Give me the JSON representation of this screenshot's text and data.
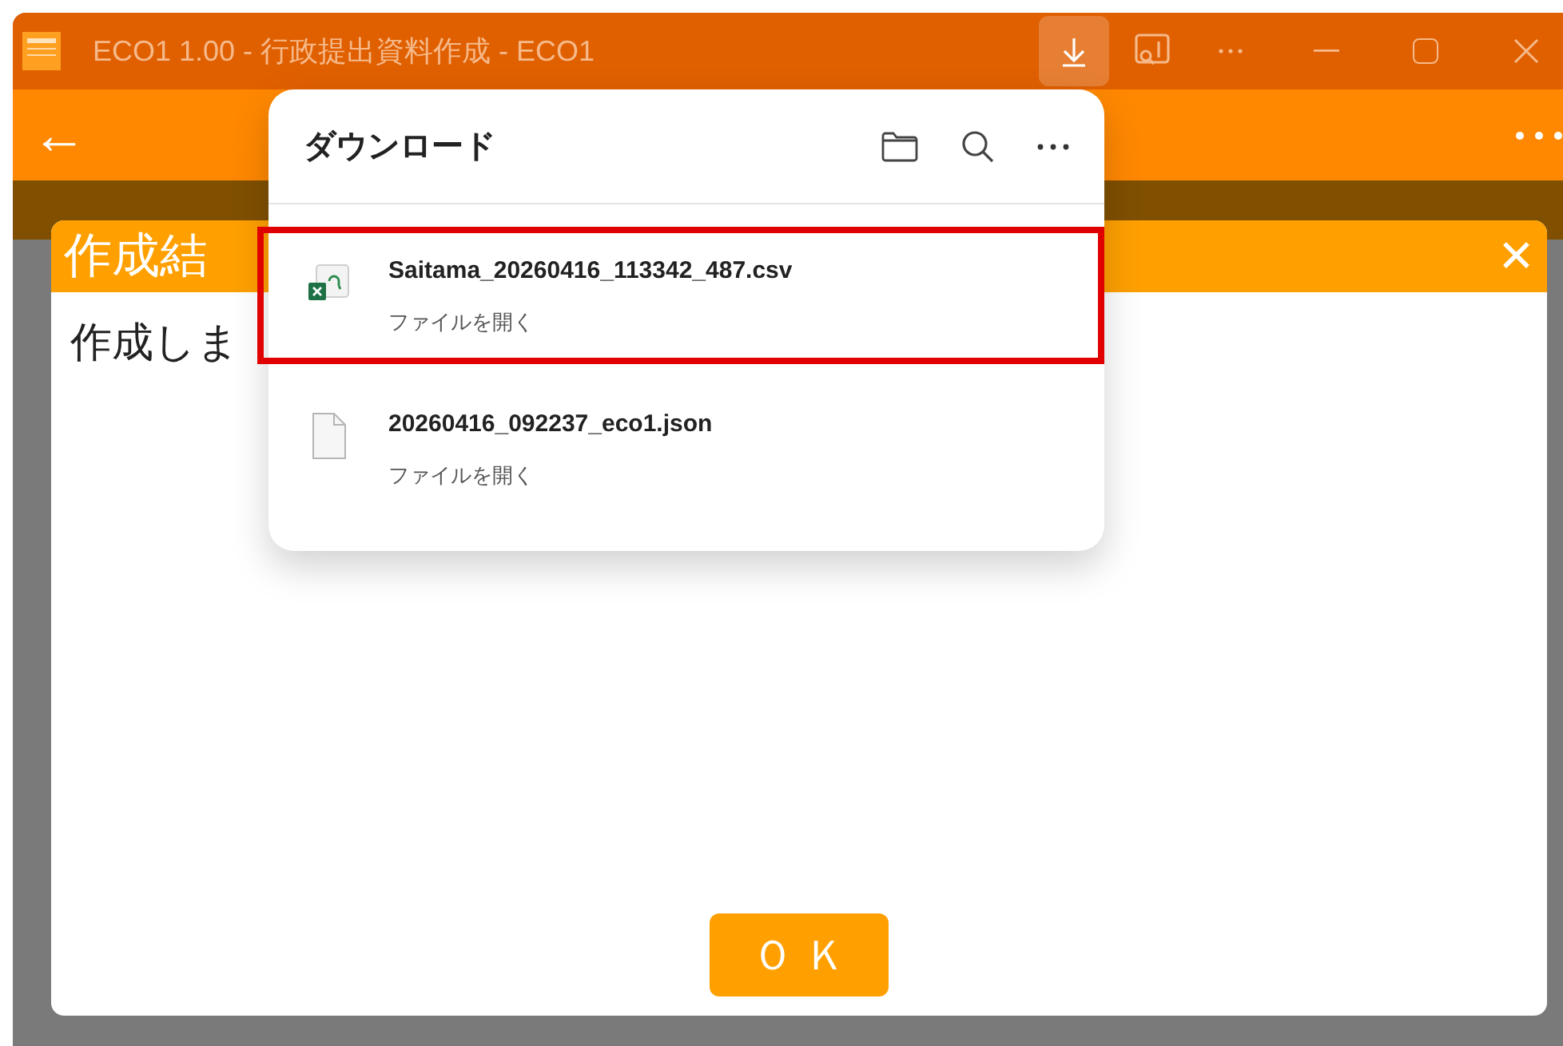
{
  "window": {
    "title": "ECO1 1.00 - 行政提出資料作成 - ECO1"
  },
  "app_header": {
    "back": "←"
  },
  "dialog": {
    "title": "作成結",
    "close": "✕",
    "message": "作成しま",
    "ok": "Ｏ Ｋ"
  },
  "downloads": {
    "title": "ダウンロード",
    "items": [
      {
        "kind": "spreadsheet",
        "name": "Saitama_20260416_113342_487.csv",
        "action": "ファイルを開く",
        "highlighted": true
      },
      {
        "kind": "file",
        "name": "20260416_092237_eco1.json",
        "action": "ファイルを開く",
        "highlighted": false
      }
    ]
  }
}
